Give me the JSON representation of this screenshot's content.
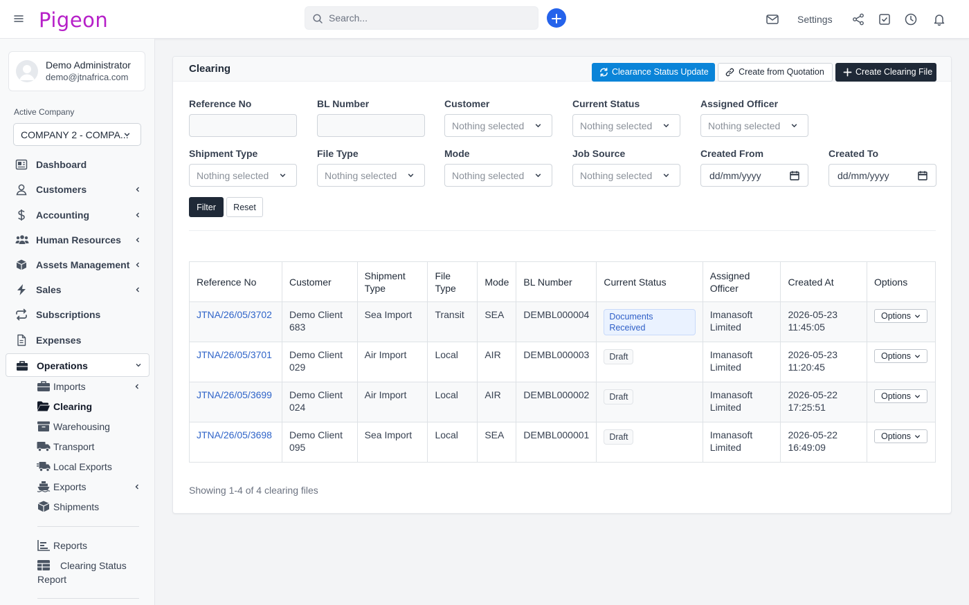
{
  "app": {
    "logo": "Pigeon"
  },
  "topbar": {
    "search_placeholder": "Search...",
    "settings_label": "Settings"
  },
  "sidebar": {
    "user_name": "Demo Administrator",
    "user_email": "demo@jtnafrica.com",
    "company_label": "Active Company",
    "company_value": "COMPANY 2 - COMPA...",
    "nav": [
      {
        "label": "Dashboard",
        "icon": "dashboard-icon"
      },
      {
        "label": "Customers",
        "icon": "user-icon"
      },
      {
        "label": "Accounting",
        "icon": "dollar-icon"
      },
      {
        "label": "Human Resources",
        "icon": "users-icon"
      },
      {
        "label": "Assets Management",
        "icon": "box-icon"
      },
      {
        "label": "Sales",
        "icon": "bolt-icon"
      },
      {
        "label": "Subscriptions",
        "icon": "repeat-icon"
      },
      {
        "label": "Expenses",
        "icon": "file-icon"
      },
      {
        "label": "Operations",
        "icon": "briefcase-icon"
      }
    ],
    "operations_sub": [
      {
        "label": "Imports",
        "icon": "briefcase-icon"
      },
      {
        "label": "Clearing",
        "icon": "folder-open-icon"
      },
      {
        "label": "Warehousing",
        "icon": "warehouse-icon"
      },
      {
        "label": "Transport",
        "icon": "truck-icon"
      },
      {
        "label": "Local Exports",
        "icon": "truck-fast-icon"
      },
      {
        "label": "Exports",
        "icon": "ship-icon"
      },
      {
        "label": "Shipments",
        "icon": "box-icon"
      }
    ],
    "reports": [
      {
        "label": "Reports",
        "icon": "chart-icon"
      },
      {
        "label_line1": "Clearing Status",
        "label_line2": "Report",
        "icon": "table-icon"
      }
    ]
  },
  "card": {
    "title": "Clearing",
    "btn_status_update": "Clearance Status Update",
    "btn_from_quotation": "Create from Quotation",
    "btn_create": "Create Clearing File"
  },
  "filters": {
    "reference_no": "Reference No",
    "bl_number": "BL Number",
    "customer": "Customer",
    "current_status": "Current Status",
    "assigned_officer": "Assigned Officer",
    "shipment_type": "Shipment Type",
    "file_type": "File Type",
    "mode": "Mode",
    "job_source": "Job Source",
    "created_from": "Created From",
    "created_to": "Created To",
    "nothing_selected": "Nothing selected",
    "date_placeholder": "dd/mm/yyyy",
    "filter_btn": "Filter",
    "reset_btn": "Reset"
  },
  "table": {
    "headers": {
      "reference_no": "Reference No",
      "customer": "Customer",
      "shipment_type_1": "Shipment",
      "shipment_type_2": "Type",
      "file_type_1": "File",
      "file_type_2": "Type",
      "mode": "Mode",
      "bl_number": "BL Number",
      "current_status": "Current Status",
      "assigned_officer_1": "Assigned",
      "assigned_officer_2": "Officer",
      "created_at": "Created At",
      "options": "Options"
    },
    "rows": [
      {
        "ref": "JTNA/26/05/3702",
        "customer_1": "Demo Client",
        "customer_2": "683",
        "shipment_type": "Sea Import",
        "file_type": "Transit",
        "mode": "SEA",
        "bl": "DEMBL000004",
        "status": "Documents Received",
        "officer_1": "Imanasoft",
        "officer_2": "Limited",
        "date": "2026-05-23",
        "time": "11:45:05",
        "options": "Options"
      },
      {
        "ref": "JTNA/26/05/3701",
        "customer_1": "Demo Client",
        "customer_2": "029",
        "shipment_type": "Air Import",
        "file_type": "Local",
        "mode": "AIR",
        "bl": "DEMBL000003",
        "status": "Draft",
        "officer_1": "Imanasoft",
        "officer_2": "Limited",
        "date": "2026-05-23",
        "time": "11:20:45",
        "options": "Options"
      },
      {
        "ref": "JTNA/26/05/3699",
        "customer_1": "Demo Client",
        "customer_2": "024",
        "shipment_type": "Air Import",
        "file_type": "Local",
        "mode": "AIR",
        "bl": "DEMBL000002",
        "status": "Draft",
        "officer_1": "Imanasoft",
        "officer_2": "Limited",
        "date": "2026-05-22",
        "time": "17:25:51",
        "options": "Options"
      },
      {
        "ref": "JTNA/26/05/3698",
        "customer_1": "Demo Client",
        "customer_2": "095",
        "shipment_type": "Sea Import",
        "file_type": "Local",
        "mode": "SEA",
        "bl": "DEMBL000001",
        "status": "Draft",
        "officer_1": "Imanasoft",
        "officer_2": "Limited",
        "date": "2026-05-22",
        "time": "16:49:09",
        "options": "Options"
      }
    ]
  },
  "footer": {
    "showing": "Showing 1-4 of 4 clearing files"
  },
  "colors": {
    "brand": "#b620c8",
    "accent_blue": "#0a84d8",
    "primary_dark": "#1f2937",
    "link": "#2f64c9"
  }
}
